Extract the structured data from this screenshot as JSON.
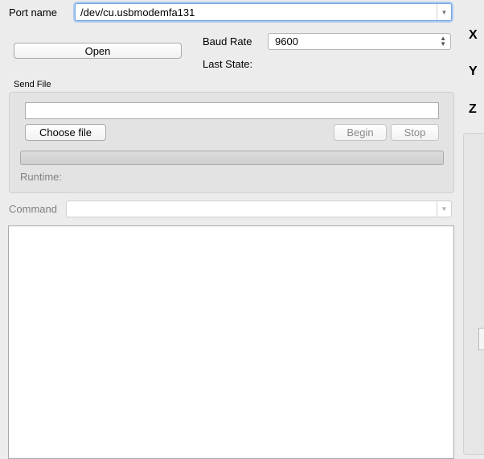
{
  "port": {
    "label": "Port name",
    "value": "/dev/cu.usbmodemfa131"
  },
  "open_button": "Open",
  "baud": {
    "label": "Baud Rate",
    "value": "9600"
  },
  "last_state": {
    "label": "Last State:",
    "value": ""
  },
  "send_file": {
    "title": "Send File",
    "file_path": "",
    "choose_label": "Choose file",
    "begin_label": "Begin",
    "stop_label": "Stop",
    "progress": 0,
    "runtime_label": "Runtime:"
  },
  "command": {
    "label": "Command",
    "value": ""
  },
  "console_text": "",
  "axes": {
    "x": "X",
    "y": "Y",
    "z": "Z"
  },
  "icons": {
    "dropdown": "chevron-down-icon",
    "stepper": "up-down-stepper-icon"
  }
}
